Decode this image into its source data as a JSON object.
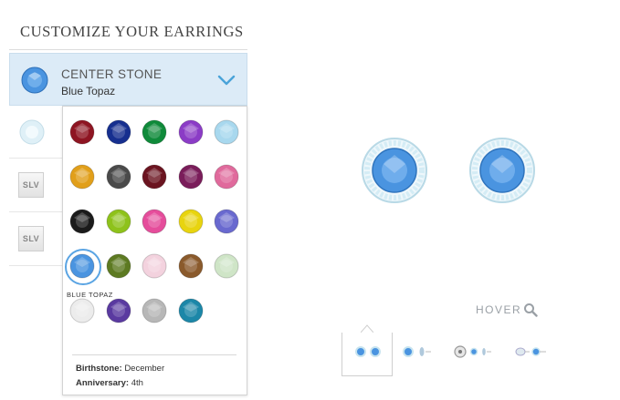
{
  "page": {
    "title": "CUSTOMIZE YOUR EARRINGS"
  },
  "center_stone": {
    "label": "CENTER STONE",
    "value": "Blue Topaz",
    "icon": "chevron-down-icon",
    "accent": "#4aa3d9"
  },
  "other_rows": [
    {
      "thumb": "stone-thumbnail-icon",
      "color": "#dff0f7"
    },
    {
      "thumb": "metal-thumbnail-icon",
      "text": "SLV"
    },
    {
      "thumb": "metal-thumbnail-icon",
      "text": "SLV"
    }
  ],
  "stones": [
    {
      "name": "garnet",
      "color": "#8e1522"
    },
    {
      "name": "sapphire",
      "color": "#162f8f"
    },
    {
      "name": "emerald",
      "color": "#0f8a3a"
    },
    {
      "name": "amethyst",
      "color": "#8b3cc6"
    },
    {
      "name": "aquamarine",
      "color": "#a8d8ee"
    },
    {
      "name": "citrine",
      "color": "#e19f1a"
    },
    {
      "name": "smoky",
      "color": "#4a4a4a"
    },
    {
      "name": "ruby",
      "color": "#6b1420"
    },
    {
      "name": "rhodolite",
      "color": "#7a1d5a"
    },
    {
      "name": "pink-tourmaline",
      "color": "#e06a9c"
    },
    {
      "name": "onyx",
      "color": "#1b1b1b"
    },
    {
      "name": "peridot",
      "color": "#8ec21b"
    },
    {
      "name": "rose",
      "color": "#e54d9b"
    },
    {
      "name": "yellow",
      "color": "#e8d40f"
    },
    {
      "name": "tanzanite",
      "color": "#6969cf"
    },
    {
      "name": "blue-topaz",
      "color": "#4a94e0"
    },
    {
      "name": "olive",
      "color": "#5d7a22"
    },
    {
      "name": "light-pink",
      "color": "#f3d2de"
    },
    {
      "name": "smoky-quartz",
      "color": "#8a5a2c"
    },
    {
      "name": "green-amethyst",
      "color": "#cfe5c7"
    },
    {
      "name": "white-topaz",
      "color": "#ececec"
    },
    {
      "name": "violet",
      "color": "#5a3aa0"
    },
    {
      "name": "silver",
      "color": "#b7b7b7"
    },
    {
      "name": "london-blue",
      "color": "#1c87a8"
    }
  ],
  "selected_index": 15,
  "selected_label": "BLUE TOPAZ",
  "info": {
    "birthstone_label": "Birthstone:",
    "birthstone_value": "December",
    "anniversary_label": "Anniversary:",
    "anniversary_value": "4th"
  },
  "preview": {
    "hover_label": "HOVER",
    "hover_icon": "magnifier-icon",
    "stone_color": "#4a94e0",
    "halo_color": "#cfe9f3"
  },
  "views": [
    {
      "name": "front-view",
      "selected": true
    },
    {
      "name": "front-side-view",
      "selected": false
    },
    {
      "name": "back-view",
      "selected": false
    },
    {
      "name": "side-view",
      "selected": false
    }
  ]
}
